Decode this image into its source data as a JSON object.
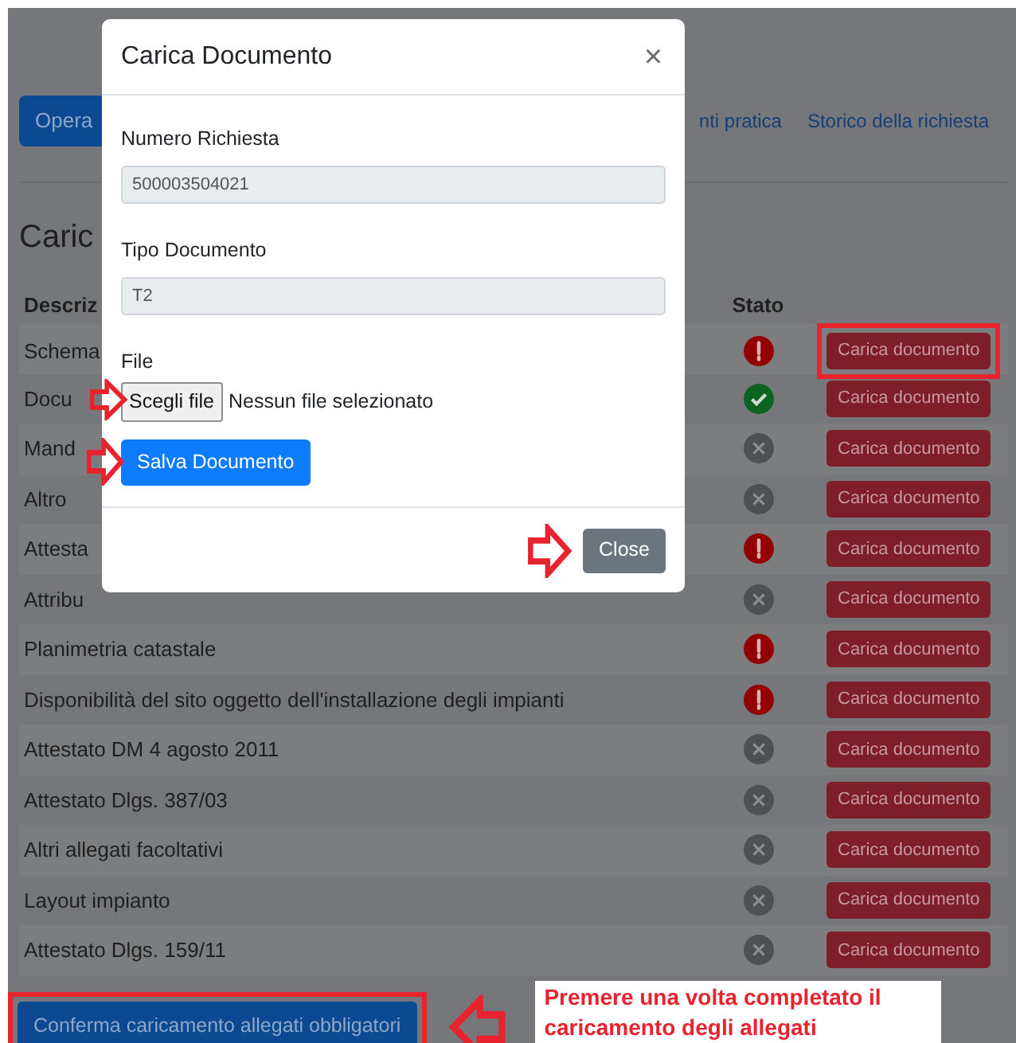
{
  "background_page": {
    "primary_button": "Opera",
    "links": [
      "nti pratica",
      "Storico della richiesta"
    ],
    "heading": "Caric",
    "table": {
      "columns": [
        "Descriz",
        "Stato"
      ],
      "rows": [
        {
          "description": "Schema",
          "status_icon": {
            "kind": "missing"
          },
          "action": "Carica documento",
          "highlighted": true
        },
        {
          "description": "Docu",
          "status_icon": {
            "kind": "uploaded"
          },
          "action": "Carica documento",
          "highlighted": false
        },
        {
          "description": "Mand",
          "status_icon": {
            "kind": "none"
          },
          "action": "Carica documento",
          "highlighted": false
        },
        {
          "description": "Altro",
          "status_icon": {
            "kind": "none"
          },
          "action": "Carica documento",
          "highlighted": false
        },
        {
          "description": "Attesta",
          "status_icon": {
            "kind": "missing"
          },
          "action": "Carica documento",
          "highlighted": false
        },
        {
          "description": "Attribu",
          "status_icon": {
            "kind": "none"
          },
          "action": "Carica documento",
          "highlighted": false
        },
        {
          "description": "Planimetria catastale",
          "status_icon": {
            "kind": "missing"
          },
          "action": "Carica documento",
          "highlighted": false
        },
        {
          "description": "Disponibilità del sito oggetto dell'installazione degli impianti",
          "status_icon": {
            "kind": "missing"
          },
          "action": "Carica documento",
          "highlighted": false
        },
        {
          "description": "Attestato DM 4 agosto 2011",
          "status_icon": {
            "kind": "none"
          },
          "action": "Carica documento",
          "highlighted": false
        },
        {
          "description": "Attestato Dlgs. 387/03",
          "status_icon": {
            "kind": "none"
          },
          "action": "Carica documento",
          "highlighted": false
        },
        {
          "description": "Altri allegati facoltativi",
          "status_icon": {
            "kind": "none"
          },
          "action": "Carica documento",
          "highlighted": false
        },
        {
          "description": "Layout impianto",
          "status_icon": {
            "kind": "none"
          },
          "action": "Carica documento",
          "highlighted": false
        },
        {
          "description": "Attestato Dlgs. 159/11",
          "status_icon": {
            "kind": "none"
          },
          "action": "Carica documento",
          "highlighted": false
        }
      ]
    },
    "confirm_button": {
      "label": "Conferma caricamento allegati obbligatori",
      "highlighted": true,
      "pointed": true
    }
  },
  "modal": {
    "title": "Carica Documento",
    "close_label": "×",
    "fields": [
      {
        "label": "Numero Richiesta",
        "value": "500003504021"
      },
      {
        "label": "Tipo Documento",
        "value": "T2"
      }
    ],
    "file": {
      "label": "File",
      "button": "Scegli file",
      "status": "Nessun file selezionato",
      "pointed": true
    },
    "save_button": {
      "label": "Salva Documento",
      "pointed": true
    },
    "footer_button": {
      "label": "Close",
      "pointed": true
    }
  },
  "note": "Premere una volta completato il caricamento degli allegati"
}
